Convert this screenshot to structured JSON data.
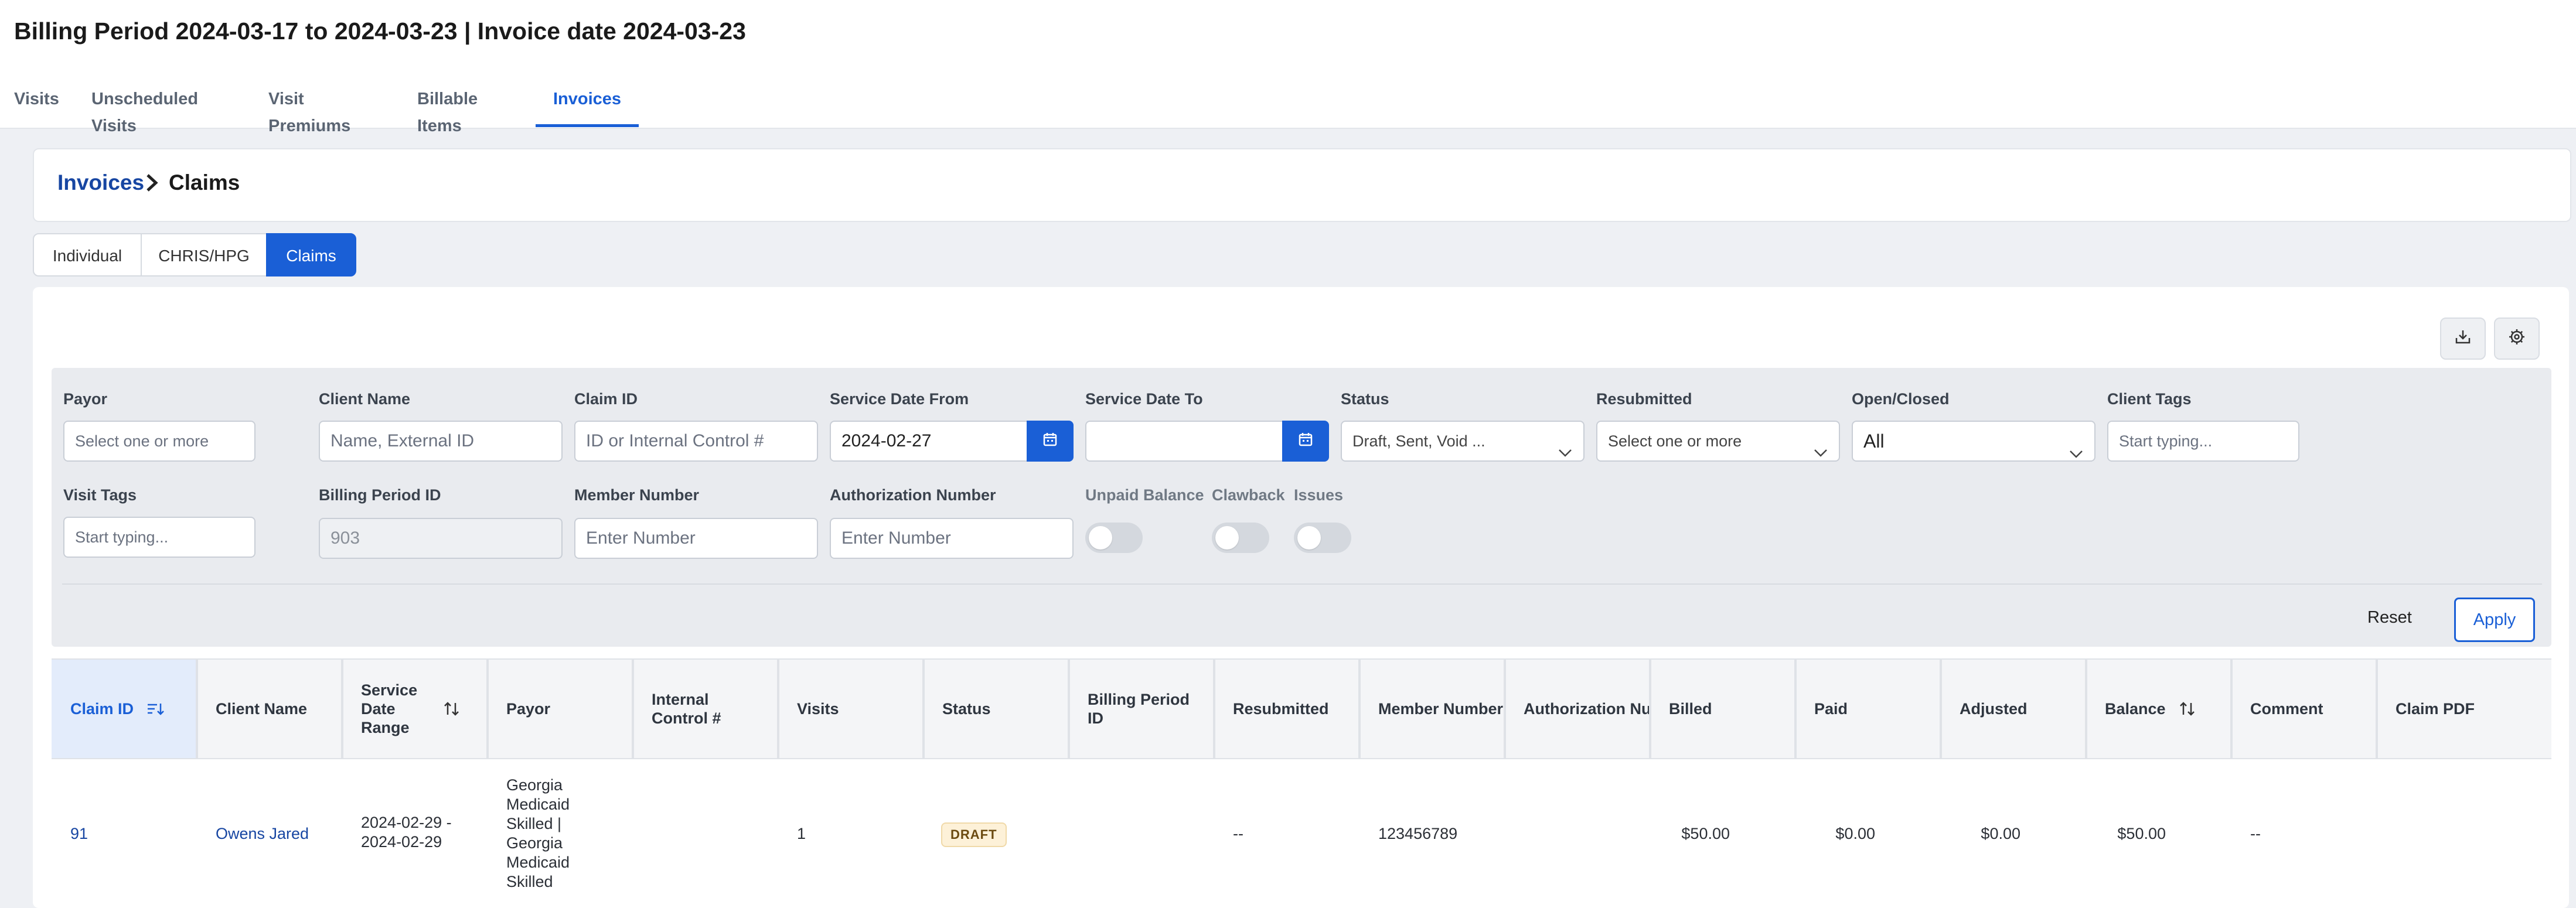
{
  "page": {
    "title": "Billing Period 2024-03-17 to 2024-03-23 | Invoice date 2024-03-23"
  },
  "tabs": [
    {
      "label": "Visits"
    },
    {
      "label": "Unscheduled Visits"
    },
    {
      "label": "Visit Premiums"
    },
    {
      "label": "Billable Items"
    },
    {
      "label": "Invoices",
      "active": true
    }
  ],
  "breadcrumb": {
    "parent": "Invoices",
    "current": "Claims"
  },
  "segments": [
    {
      "label": "Individual"
    },
    {
      "label": "CHRIS/HPG"
    },
    {
      "label": "Claims",
      "active": true
    }
  ],
  "toolbar": {
    "download_icon": "download-icon",
    "settings_icon": "gear-icon"
  },
  "filters": {
    "payor": {
      "label": "Payor",
      "placeholder": "Select one or more"
    },
    "client_name": {
      "label": "Client Name",
      "placeholder": "Name, External ID"
    },
    "claim_id": {
      "label": "Claim ID",
      "placeholder": "ID or Internal Control #"
    },
    "service_date_from": {
      "label": "Service Date From",
      "value": "2024-02-27"
    },
    "service_date_to": {
      "label": "Service Date To",
      "value": ""
    },
    "status": {
      "label": "Status",
      "value": "Draft, Sent, Void ..."
    },
    "resubmitted": {
      "label": "Resubmitted",
      "value": "Select one or more"
    },
    "open_closed": {
      "label": "Open/Closed",
      "value": "All"
    },
    "client_tags": {
      "label": "Client Tags",
      "placeholder": "Start typing..."
    },
    "visit_tags": {
      "label": "Visit Tags",
      "placeholder": "Start typing..."
    },
    "billing_period_id": {
      "label": "Billing Period ID",
      "value": "903"
    },
    "member_number": {
      "label": "Member Number",
      "placeholder": "Enter Number"
    },
    "authorization_number": {
      "label": "Authorization Number",
      "placeholder": "Enter Number"
    },
    "unpaid_balance": {
      "label": "Unpaid Balance",
      "on": false
    },
    "clawback": {
      "label": "Clawback",
      "on": false
    },
    "issues": {
      "label": "Issues",
      "on": false
    },
    "reset_label": "Reset",
    "apply_label": "Apply"
  },
  "table": {
    "columns": [
      {
        "label": "Claim ID"
      },
      {
        "label": "Client Name"
      },
      {
        "label": "Service Date Range"
      },
      {
        "label": "Payor"
      },
      {
        "label": "Internal Control #"
      },
      {
        "label": "Visits"
      },
      {
        "label": "Status"
      },
      {
        "label": "Billing Period ID"
      },
      {
        "label": "Resubmitted"
      },
      {
        "label": "Member Number"
      },
      {
        "label": "Authorization Nu"
      },
      {
        "label": "Billed"
      },
      {
        "label": "Paid"
      },
      {
        "label": "Adjusted"
      },
      {
        "label": "Balance"
      },
      {
        "label": "Comment"
      },
      {
        "label": "Claim PDF"
      }
    ],
    "rows": [
      {
        "claim_id": "91",
        "client_name": "Owens Jared",
        "service_date_range": "2024-02-29 - 2024-02-29",
        "payor": "Georgia Medicaid Skilled | Georgia Medicaid Skilled",
        "internal_control": "",
        "visits": "1",
        "status": "DRAFT",
        "billing_period_id": "",
        "resubmitted": "--",
        "member_number": "123456789",
        "authorization_number": "",
        "billed": "$50.00",
        "paid": "$0.00",
        "adjusted": "$0.00",
        "balance": "$50.00",
        "comment": "--",
        "claim_pdf": ""
      }
    ]
  },
  "colors": {
    "accent": "#1a5fd6",
    "link": "#1746a2",
    "panel": "#e9ebef",
    "draft_badge": "#fdf1d8"
  }
}
